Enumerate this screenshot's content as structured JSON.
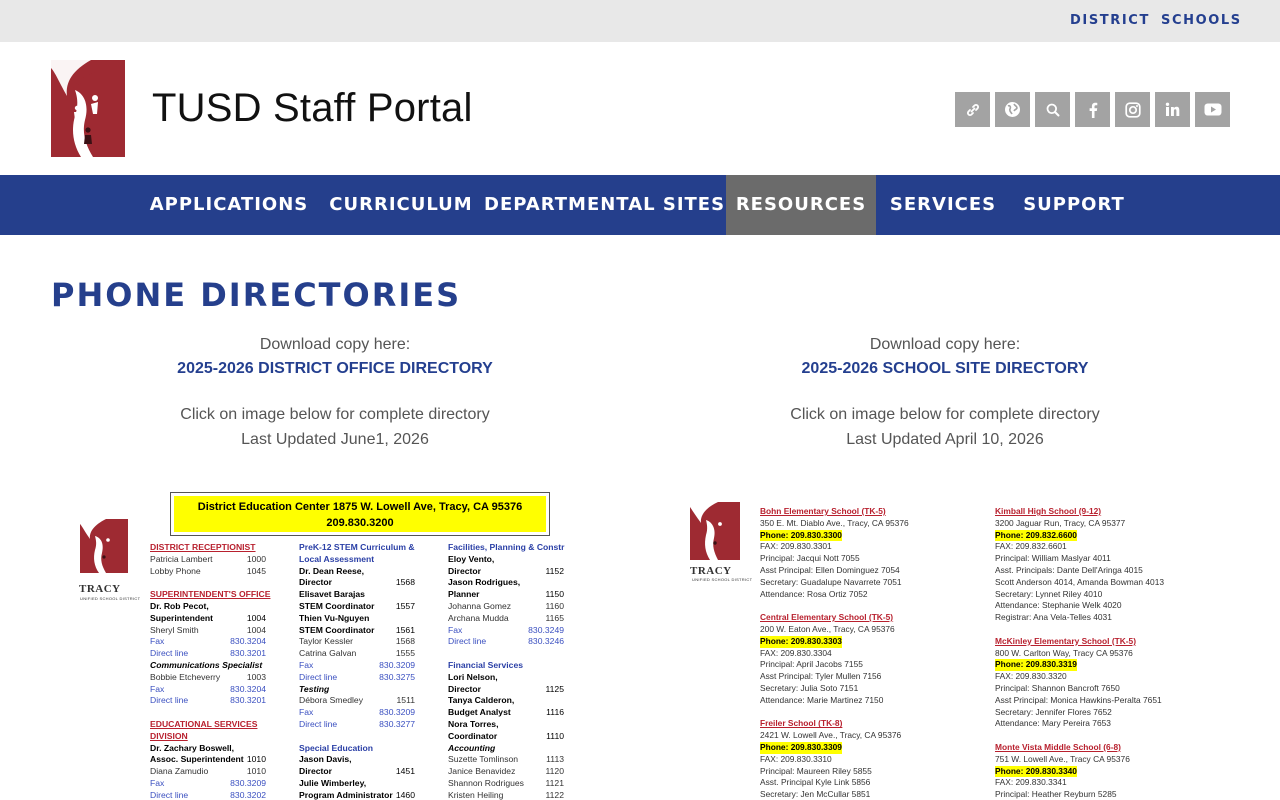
{
  "topbar": {
    "district": "DISTRICT",
    "schools": "SCHOOLS"
  },
  "header": {
    "title": "TUSD Staff Portal"
  },
  "social_icons": [
    "link-icon",
    "globe-icon",
    "search-icon",
    "facebook-icon",
    "instagram-icon",
    "linkedin-icon",
    "youtube-icon"
  ],
  "nav": {
    "items": [
      "APPLICATIONS",
      "CURRICULUM",
      "DEPARTMENTAL SITES",
      "RESOURCES",
      "SERVICES",
      "SUPPORT"
    ],
    "active": "RESOURCES"
  },
  "page": {
    "title": "PHONE DIRECTORIES",
    "left": {
      "download_label": "Download copy here:",
      "link": "2025-2026 DISTRICT OFFICE DIRECTORY",
      "click_text": "Click on image below for complete directory",
      "updated": "Last Updated June1, 2026"
    },
    "right": {
      "download_label": "Download copy here:",
      "link": "2025-2026 SCHOOL SITE DIRECTORY",
      "click_text": "Click on image below for complete directory",
      "updated": "Last Updated April 10, 2026"
    }
  },
  "district_preview": {
    "banner_line1": "District Education Center 1875 W. Lowell Ave, Tracy, CA  95376",
    "banner_line2": "209.830.3200",
    "logo_text": "TRACY",
    "logo_sub": "UNIFIED SCHOOL DISTRICT",
    "col1": [
      {
        "t": "DISTRICT RECEPTIONIST",
        "c": "h"
      },
      {
        "t": "Patricia Lambert",
        "v": "1000"
      },
      {
        "t": "Lobby Phone",
        "v": "1045"
      },
      {
        "t": "",
        "c": "sp"
      },
      {
        "t": "SUPERINTENDENT'S OFFICE",
        "c": "h"
      },
      {
        "t": "Dr. Rob Pecot,",
        "c": "b"
      },
      {
        "t": "Superintendent",
        "v": "1004",
        "c": "b"
      },
      {
        "t": "Sheryl Smith",
        "v": "1004"
      },
      {
        "t": "Fax",
        "v": "830.3204",
        "c": "lnk"
      },
      {
        "t": "Direct line",
        "v": "830.3201",
        "c": "lnk"
      },
      {
        "t": "Communications Specialist",
        "c": "bi"
      },
      {
        "t": "Bobbie Etcheverry",
        "v": "1003"
      },
      {
        "t": "Fax",
        "v": "830.3204",
        "c": "lnk"
      },
      {
        "t": "Direct line",
        "v": "830.3201",
        "c": "lnk"
      },
      {
        "t": "",
        "c": "sp"
      },
      {
        "t": "EDUCATIONAL SERVICES",
        "c": "h"
      },
      {
        "t": "DIVISION",
        "c": "h"
      },
      {
        "t": "Dr. Zachary Boswell,",
        "c": "b"
      },
      {
        "t": "Assoc. Superintendent",
        "v": "1010",
        "c": "b"
      },
      {
        "t": "Diana Zamudio",
        "v": "1010"
      },
      {
        "t": "Fax",
        "v": "830.3209",
        "c": "lnk"
      },
      {
        "t": "Direct line",
        "v": "830.3202",
        "c": "lnk"
      }
    ],
    "col2": [
      {
        "t": "PreK-12 STEM Curriculum &",
        "c": "hb"
      },
      {
        "t": "Local Assessment",
        "c": "hb"
      },
      {
        "t": "Dr. Dean Reese,",
        "c": "b"
      },
      {
        "t": "Director",
        "v": "1568",
        "c": "b"
      },
      {
        "t": "Elisavet Barajas",
        "c": "b"
      },
      {
        "t": "STEM Coordinator",
        "v": "1557",
        "c": "b"
      },
      {
        "t": "Thien Vu-Nguyen",
        "c": "b"
      },
      {
        "t": "STEM Coordinator",
        "v": "1561",
        "c": "b"
      },
      {
        "t": "Taylor Kessler",
        "v": "1568"
      },
      {
        "t": "Catrina Galvan",
        "v": "1555"
      },
      {
        "t": "Fax",
        "v": "830.3209",
        "c": "lnk"
      },
      {
        "t": "Direct line",
        "v": "830.3275",
        "c": "lnk"
      },
      {
        "t": "Testing",
        "c": "bi"
      },
      {
        "t": "Débora Smedley",
        "v": "1511"
      },
      {
        "t": "Fax",
        "v": "830.3209",
        "c": "lnk"
      },
      {
        "t": "Direct line",
        "v": "830.3277",
        "c": "lnk"
      },
      {
        "t": "",
        "c": "sp"
      },
      {
        "t": "Special Education",
        "c": "hb"
      },
      {
        "t": "Jason Davis,",
        "c": "b"
      },
      {
        "t": "Director",
        "v": "1451",
        "c": "b"
      },
      {
        "t": "Julie Wimberley,",
        "c": "b"
      },
      {
        "t": "Program Administrator",
        "v": "1460",
        "c": "b"
      }
    ],
    "col3": [
      {
        "t": "Facilities, Planning & Constr",
        "c": "hb"
      },
      {
        "t": "Eloy Vento,",
        "c": "b"
      },
      {
        "t": "Director",
        "v": "1152",
        "c": "b"
      },
      {
        "t": "Jason Rodrigues,",
        "c": "b"
      },
      {
        "t": "Planner",
        "v": "1150",
        "c": "b"
      },
      {
        "t": "Johanna Gomez",
        "v": "1160"
      },
      {
        "t": "Archana Mudda",
        "v": "1165"
      },
      {
        "t": "Fax",
        "v": "830.3249",
        "c": "lnk"
      },
      {
        "t": "Direct line",
        "v": "830.3246",
        "c": "lnk"
      },
      {
        "t": "",
        "c": "sp"
      },
      {
        "t": "Financial Services",
        "c": "hb"
      },
      {
        "t": "Lori Nelson,",
        "c": "b"
      },
      {
        "t": "Director",
        "v": "1125",
        "c": "b"
      },
      {
        "t": "Tanya Calderon,",
        "c": "b"
      },
      {
        "t": "Budget Analyst",
        "v": "1116",
        "c": "b"
      },
      {
        "t": "Nora Torres,",
        "c": "b"
      },
      {
        "t": "Coordinator",
        "v": "1110",
        "c": "b"
      },
      {
        "t": "Accounting",
        "c": "bi"
      },
      {
        "t": "Suzette Tomlinson",
        "v": "1113"
      },
      {
        "t": "Janice Benavidez",
        "v": "1120"
      },
      {
        "t": "Shannon Rodrigues",
        "v": "1121"
      },
      {
        "t": "Kristen Heiling",
        "v": "1122"
      }
    ]
  },
  "school_preview": {
    "logo_text": "TRACY",
    "logo_sub": "UNIFIED SCHOOL DISTRICT",
    "col1": [
      {
        "t": "Bohn Elementary School (TK-5)",
        "c": "h"
      },
      {
        "t": "350 E. Mt. Diablo Ave., Tracy, CA  95376"
      },
      {
        "t": "Phone:  209.830.3300",
        "c": "ph"
      },
      {
        "t": "FAX:     209.830.3301"
      },
      {
        "t": "Principal:  Jacqui Nott 7055"
      },
      {
        "t": "Asst Principal: Ellen Dominguez 7054"
      },
      {
        "t": "Secretary:  Guadalupe Navarrete 7051"
      },
      {
        "t": "Attendance:  Rosa Ortiz 7052"
      },
      {
        "t": "",
        "c": "sp"
      },
      {
        "t": "Central Elementary School (TK-5)",
        "c": "h"
      },
      {
        "t": "200 W. Eaton Ave., Tracy, CA  95376"
      },
      {
        "t": "Phone:  209.830.3303",
        "c": "ph"
      },
      {
        "t": "FAX:     209.830.3304"
      },
      {
        "t": "Principal:  April Jacobs 7155"
      },
      {
        "t": "Asst Principal: Tyler Mullen 7156"
      },
      {
        "t": "Secretary:  Julia Soto 7151"
      },
      {
        "t": "Attendance: Marie Martinez  7150"
      },
      {
        "t": "",
        "c": "sp"
      },
      {
        "t": "Freiler School (TK-8)",
        "c": "h"
      },
      {
        "t": "2421 W. Lowell Ave., Tracy, CA  95376"
      },
      {
        "t": "Phone:  209.830.3309",
        "c": "ph"
      },
      {
        "t": "FAX:     209.830.3310"
      },
      {
        "t": "Principal:  Maureen Riley 5855"
      },
      {
        "t": "Asst. Principal  Kyle Link 5856"
      },
      {
        "t": "Secretary: Jen McCullar 5851"
      }
    ],
    "col2": [
      {
        "t": "Kimball High School (9-12)",
        "c": "h"
      },
      {
        "t": "3200 Jaguar Run, Tracy, CA 95377"
      },
      {
        "t": "Phone:   209.832.6600",
        "c": "ph"
      },
      {
        "t": "FAX:     209.832.6601"
      },
      {
        "t": "Principal: William Maslyar 4011"
      },
      {
        "t": "Asst. Principals: Dante Dell'Aringa 4015"
      },
      {
        "t": "Scott Anderson 4014, Amanda Bowman 4013"
      },
      {
        "t": "Secretary:  Lynnet Riley 4010"
      },
      {
        "t": "Attendance: Stephanie Welk 4020"
      },
      {
        "t": "Registrar: Ana Vela-Telles 4031"
      },
      {
        "t": "",
        "c": "sp"
      },
      {
        "t": "McKinley Elementary School (TK-5)",
        "c": "h"
      },
      {
        "t": "800 W. Carlton Way, Tracy CA  95376"
      },
      {
        "t": "Phone: 209.830.3319",
        "c": "ph"
      },
      {
        "t": "FAX:     209.830.3320"
      },
      {
        "t": "Principal: Shannon Bancroft 7650"
      },
      {
        "t": "Asst Principal: Monica Hawkins-Peralta 7651"
      },
      {
        "t": "Secretary:  Jennifer Flores 7652"
      },
      {
        "t": "Attendance:  Mary Pereira 7653"
      },
      {
        "t": "",
        "c": "sp"
      },
      {
        "t": "Monte Vista Middle School (6-8)",
        "c": "h"
      },
      {
        "t": "751 W. Lowell Ave., Tracy CA  95376"
      },
      {
        "t": "Phone: 209.830.3340",
        "c": "ph"
      },
      {
        "t": "FAX:     209.830.3341"
      },
      {
        "t": "Principal:  Heather Reyburn 5285"
      }
    ]
  }
}
